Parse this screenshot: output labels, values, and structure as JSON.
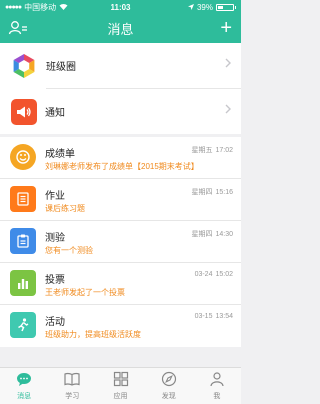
{
  "status": {
    "carrier": "中国移动",
    "time": "11:03",
    "battery_text": "39%",
    "battery_level": 0.39
  },
  "nav": {
    "title": "消息",
    "add_label": "+"
  },
  "groups": [
    {
      "label": "班级圈"
    },
    {
      "label": "通知"
    }
  ],
  "messages": [
    {
      "title": "成绩单",
      "subtitle": "刘琳娜老师发布了成绩单【2015期末考试】",
      "day": "星期五",
      "time": "17:02",
      "color": "#f5a623"
    },
    {
      "title": " 作业",
      "subtitle": "课后练习题",
      "day": "星期四",
      "time": "15:16",
      "color": "#ff7a1a"
    },
    {
      "title": "测验",
      "subtitle": "您有一个测验",
      "day": "星期四",
      "time": "14:30",
      "color": "#3f8be8"
    },
    {
      "title": "投票",
      "subtitle": "王老师发起了一个投票",
      "day": "03-24",
      "time": "15:02",
      "color": "#7cc443"
    },
    {
      "title": "活动",
      "subtitle": "班级助力，提高班级活跃度",
      "day": "03-15",
      "time": "13:54",
      "color": "#3fc9b0"
    }
  ],
  "tabs": [
    {
      "label": "消息",
      "active": true
    },
    {
      "label": "学习",
      "active": false
    },
    {
      "label": "应用",
      "active": false
    },
    {
      "label": "发现",
      "active": false
    },
    {
      "label": "我",
      "active": false
    }
  ],
  "colors": {
    "accent": "#2ebc9b",
    "subtitle": "#f08a1d"
  }
}
